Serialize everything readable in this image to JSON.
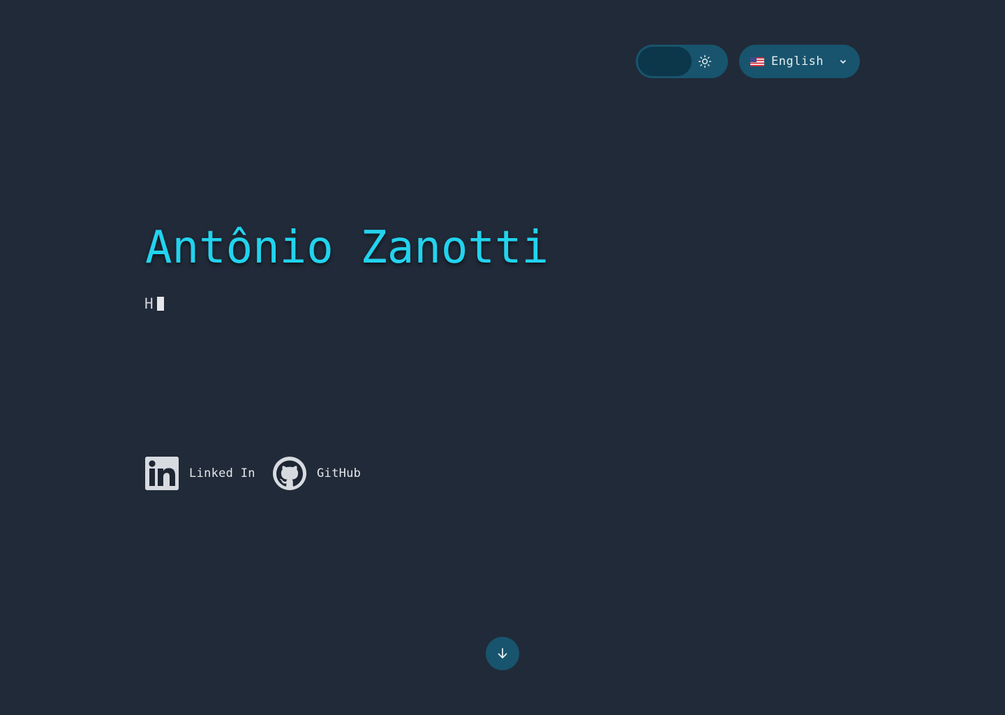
{
  "header": {
    "theme_toggle": {
      "state": "dark",
      "icon": "sun-icon"
    },
    "language": {
      "flag": "us-flag-icon",
      "selected": "English",
      "icon": "chevron-down-icon"
    }
  },
  "hero": {
    "name": "Antônio Zanotti",
    "typed_text": "H"
  },
  "social": [
    {
      "label": "Linked In",
      "icon": "linkedin-icon"
    },
    {
      "label": "GitHub",
      "icon": "github-icon"
    }
  ],
  "scroll_button": {
    "icon": "arrow-down-icon"
  },
  "colors": {
    "background": "#212a38",
    "accent": "#22d3ee",
    "control_bg": "#18546d",
    "toggle_knob": "#0c3649"
  }
}
